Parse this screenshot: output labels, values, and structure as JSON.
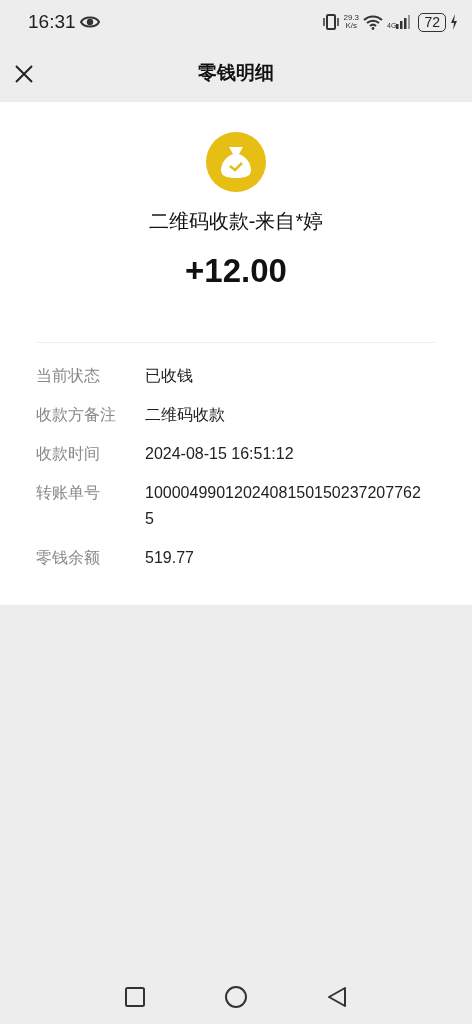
{
  "status_bar": {
    "time": "16:31",
    "net_speed": "29.3",
    "net_speed_unit": "K/s",
    "network_type": "4G",
    "battery": "72"
  },
  "header": {
    "title": "零钱明细"
  },
  "summary": {
    "title": "二维码收款-来自*婷",
    "amount": "+12.00"
  },
  "details": [
    {
      "label": "当前状态",
      "value": "已收钱"
    },
    {
      "label": "收款方备注",
      "value": "二维码收款"
    },
    {
      "label": "收款时间",
      "value": "2024-08-15 16:51:12"
    },
    {
      "label": "转账单号",
      "value": "10000499012024081501502372077625"
    },
    {
      "label": "零钱余额",
      "value": "519.77"
    }
  ]
}
